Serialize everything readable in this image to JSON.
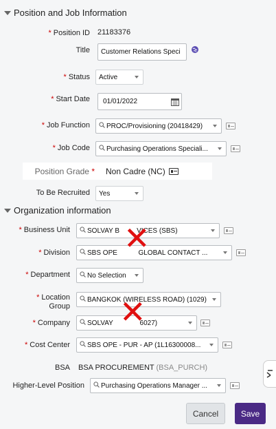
{
  "position_section": {
    "title": "Position and Job Information",
    "position_id": {
      "label": "Position ID",
      "value": "21183376"
    },
    "title_field": {
      "label": "Title",
      "value": "Customer Relations Speci"
    },
    "status": {
      "label": "Status",
      "value": "Active"
    },
    "start_date": {
      "label": "Start Date",
      "value": "01/01/2022"
    },
    "job_function": {
      "label": "Job Function",
      "value": "PROC/Provisioning (20418429)"
    },
    "job_code": {
      "label": "Job Code",
      "value": "Purchasing Operations Speciali..."
    },
    "position_grade": {
      "label": "Position Grade",
      "value": "Non Cadre (NC)"
    },
    "to_be_recruited": {
      "label": "To Be Recruited",
      "value": "Yes"
    }
  },
  "org_section": {
    "title": "Organization information",
    "business_unit": {
      "label": "Business Unit",
      "value": "SOLVAY B         VICES (SBS)"
    },
    "division": {
      "label": "Division",
      "value": "SBS OPE           GLOBAL CONTACT ..."
    },
    "department": {
      "label": "Department",
      "value": "No Selection"
    },
    "location_group": {
      "label_line1": "Location",
      "label_line2": "Group",
      "value": "BANGKOK (WIRELESS ROAD) (1029)"
    },
    "company": {
      "label": "Company",
      "value": "SOLVAY              6027)"
    },
    "cost_center": {
      "label": "Cost Center",
      "value": "SBS OPE - PUR - AP (1L16300008..."
    },
    "bsa": {
      "label": "BSA",
      "value": "BSA PROCUREMENT",
      "code": "(BSA_PURCH)"
    },
    "higher_level_position": {
      "label": "Higher-Level Position",
      "value": "Purchasing Operations Manager ..."
    }
  },
  "buttons": {
    "cancel": "Cancel",
    "save": "Save"
  },
  "required_marker": "*",
  "colors": {
    "save_bg": "#4a2a85",
    "required": "#cc0000",
    "redaction": "#e01010"
  },
  "icons": {
    "search": "magnifier-icon",
    "calendar": "calendar-icon",
    "globe": "globe-icon",
    "details": "details-card-icon",
    "collapse": "triangle-down-icon"
  }
}
